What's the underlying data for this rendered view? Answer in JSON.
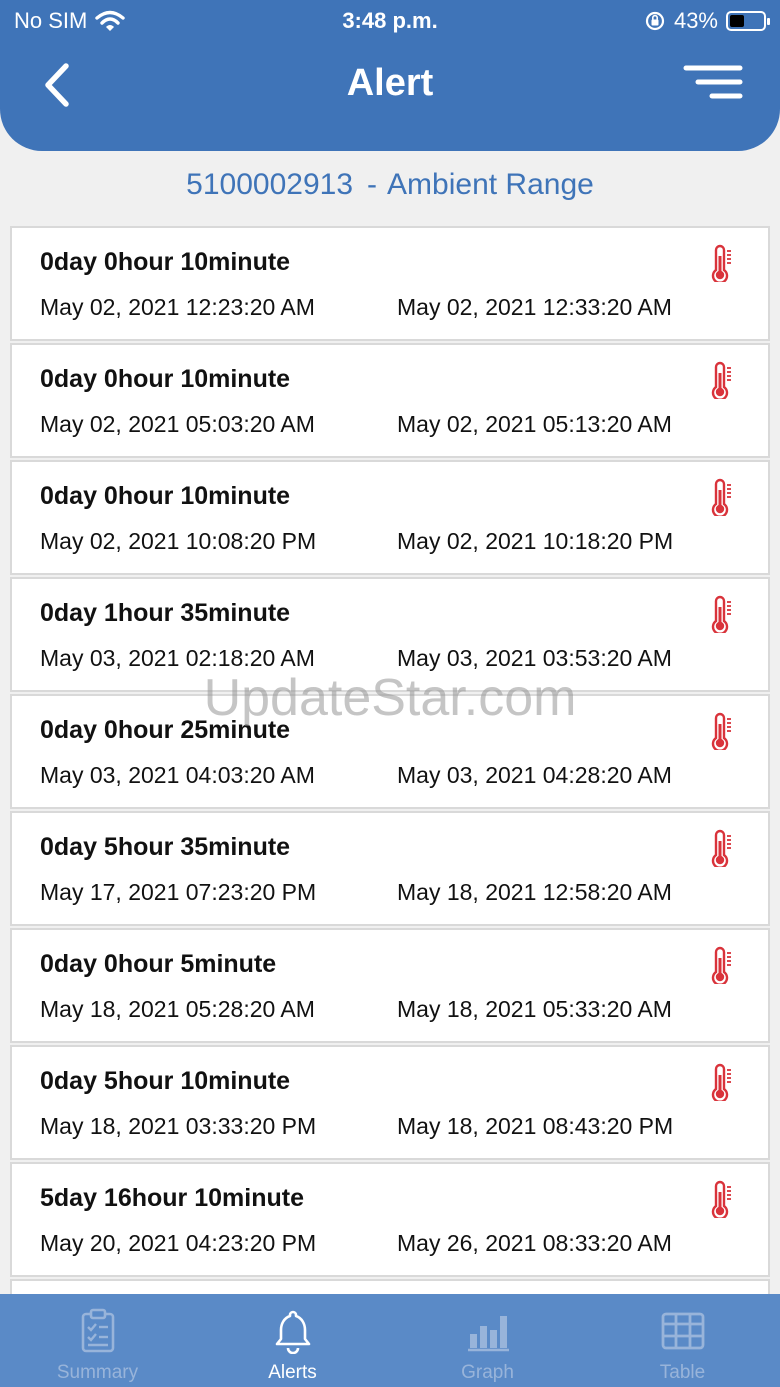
{
  "status_bar": {
    "carrier": "No SIM",
    "time": "3:48 p.m.",
    "battery": "43%",
    "battery_level": 0.43
  },
  "header": {
    "title": "Alert",
    "back_icon": "chevron-left-icon",
    "menu_icon": "filter-menu-icon"
  },
  "subtitle": {
    "device_id": "5100002913",
    "separator": "-",
    "range": "Ambient Range"
  },
  "alerts": [
    {
      "duration": "0day 0hour 10minute",
      "start": "May 02, 2021 12:23:20 AM",
      "end": "May 02, 2021 12:33:20 AM"
    },
    {
      "duration": "0day 0hour 10minute",
      "start": "May 02, 2021 05:03:20 AM",
      "end": "May 02, 2021 05:13:20 AM"
    },
    {
      "duration": "0day 0hour 10minute",
      "start": "May 02, 2021 10:08:20 PM",
      "end": "May 02, 2021 10:18:20 PM"
    },
    {
      "duration": "0day 1hour 35minute",
      "start": "May 03, 2021 02:18:20 AM",
      "end": "May 03, 2021 03:53:20 AM"
    },
    {
      "duration": "0day 0hour 25minute",
      "start": "May 03, 2021 04:03:20 AM",
      "end": "May 03, 2021 04:28:20 AM"
    },
    {
      "duration": "0day 5hour 35minute",
      "start": "May 17, 2021 07:23:20 PM",
      "end": "May 18, 2021 12:58:20 AM"
    },
    {
      "duration": "0day 0hour 5minute",
      "start": "May 18, 2021 05:28:20 AM",
      "end": "May 18, 2021 05:33:20 AM"
    },
    {
      "duration": "0day 5hour 10minute",
      "start": "May 18, 2021 03:33:20 PM",
      "end": "May 18, 2021 08:43:20 PM"
    },
    {
      "duration": "5day 16hour 10minute",
      "start": "May 20, 2021 04:23:20 PM",
      "end": "May 26, 2021 08:33:20 AM"
    }
  ],
  "watermark": "UpdateStar.com",
  "tabs": [
    {
      "label": "Summary",
      "icon": "clipboard-checklist-icon",
      "active": false
    },
    {
      "label": "Alerts",
      "icon": "bell-icon",
      "active": true
    },
    {
      "label": "Graph",
      "icon": "bar-chart-icon",
      "active": false
    },
    {
      "label": "Table",
      "icon": "table-grid-icon",
      "active": false
    }
  ],
  "colors": {
    "header": "#3f74b8",
    "tabbar": "#5a8ac7",
    "accent_text": "#3f74b8",
    "alert_icon": "#d9333b"
  }
}
